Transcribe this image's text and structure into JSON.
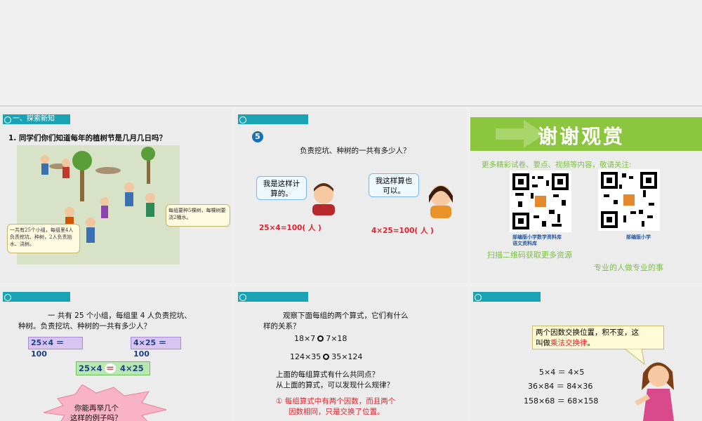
{
  "slide1": {
    "tab": "一、探索新知",
    "question": "1. 同学们你们知道每年的植树节是几月几日吗？",
    "bubble_right": "每组要种5棵树，每棵树要浇2桶水。",
    "bubble_left": "一共有25个小组，每组里4人负责挖坑、种树，2人负责抬水、浇树。"
  },
  "slide2": {
    "number": "5",
    "question": "负责挖坑、种树的一共有多少人？",
    "boy_bubble": "我是这样计算的。",
    "girl_bubble": "我这样算也可以。",
    "eq_left": "25×4=100( 人 )",
    "eq_right": "4×25=100( 人 )"
  },
  "slide3": {
    "banner_title": "谢谢观赏",
    "subtitle": "更多精彩试卷、要点、视频等内容，敬请关注:",
    "qr1_caption": "部编版小学数学资料库",
    "qr1_caption2": "语文资料库",
    "qr2_caption": "部编版小学",
    "scan_text": "扫描二维码获取更多资源",
    "motto": "专业的人做专业的事"
  },
  "slide4": {
    "text_line1": "一  共有 25 个小组，每组里 4 人负责挖坑、",
    "text_line2": "种树。负责挖坑、种树的一共有多少人？",
    "eq1": "25×4 ＝ 100",
    "eq2": "4×25 ＝ 100",
    "combined_left": "25×4",
    "combined_sign": "＝",
    "combined_right": "4×25",
    "star_line1": "你能再举几个",
    "star_line2": "这样的例子吗？"
  },
  "slide5": {
    "text_line1": "观察下面每组的两个算式，它们有什么",
    "text_line2": "样的关系？",
    "eq1_left": "18×7",
    "eq1_right": "7×18",
    "eq2_left": "124×35",
    "eq2_right": "35×124",
    "q1": "上面的每组算式有什么共同点？",
    "q2": "从上面的算式，可以发现什么规律？",
    "answer_line1": "① 每组算式中有两个因数，而且两个",
    "answer_line2": "因数相同，只是交换了位置。"
  },
  "slide6": {
    "note_line1": "两个因数交换位置，积不变，这",
    "note_line2_prefix": "叫做",
    "note_highlight": "乘法交换律",
    "note_suffix": "。",
    "eq1": "5×4 ＝ 4×5",
    "eq2": "36×84 ＝ 84×36",
    "eq3": "158×68 ＝ 68×158"
  },
  "colors": {
    "tab": "#19a3b4",
    "banner_green": "#8cc63f",
    "red": "#e8202a",
    "green_text": "#7bc142",
    "purple_box": "#d9c6f0"
  }
}
